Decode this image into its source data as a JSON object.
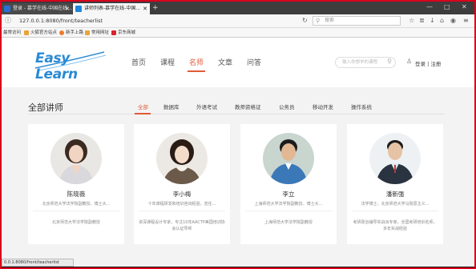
{
  "browser": {
    "tabs": [
      {
        "title": "登录 - 慕学在线-中国在线..."
      },
      {
        "title": "讲师列表-慕学在线-中国..."
      }
    ],
    "new_tab": "+",
    "window_controls": [
      "—",
      "□",
      "✕"
    ],
    "url": "127.0.0.1:8080/front/teacherlist",
    "search_placeholder": "搜索",
    "bookmarks": [
      "最常访问",
      "火狐官方站点",
      "新手上路",
      "常用网址",
      "京东商城"
    ],
    "status_url": "0.0.1:8080/front/teacherlist"
  },
  "site": {
    "logo": "Easy Learn",
    "nav": [
      "首页",
      "课程",
      "名师",
      "文章",
      "问答"
    ],
    "active_nav": "名师",
    "search_placeholder": "输入你想学的课程",
    "login": "登录 | 注册"
  },
  "section": {
    "title": "全部讲师",
    "filters": [
      "全部",
      "数据库",
      "外语考试",
      "教师资格证",
      "公务员",
      "移动开发",
      "操作系统"
    ],
    "active_filter": "全部"
  },
  "teachers": [
    {
      "name": "陈晓薇",
      "desc": "北京师范大学法学院副教授、博士大...",
      "school": "北京师范大学法学院副教授"
    },
    {
      "name": "李小梅",
      "desc": "十年课程研发和培训咨询经验，曾任...",
      "school": "资深课程设计专家，专注10年AACTP美国培训协会认证导师"
    },
    {
      "name": "李立",
      "desc": "上海师范大学法学院副教授、博士大...",
      "school": "上海师范大学法学院副教授"
    },
    {
      "name": "潘新强",
      "desc": "法学博士，北京师范大学马院思主义...",
      "school": "考研政治辅导实战派专家，全国考研培训名师，多年实战经验"
    }
  ]
}
